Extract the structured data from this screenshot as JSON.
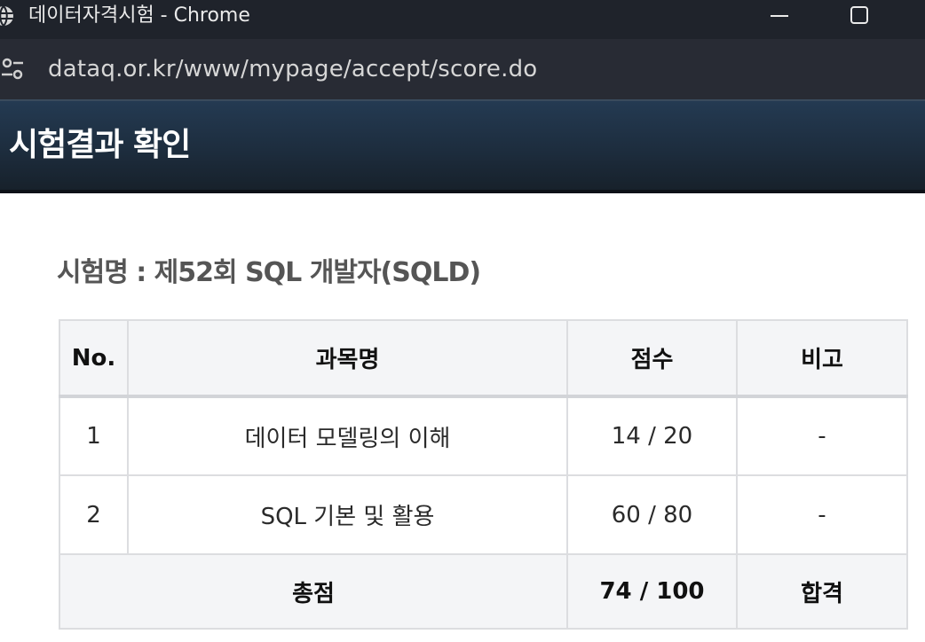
{
  "window": {
    "title": "데이터자격시험 - Chrome",
    "minimize_icon": "minimize-icon",
    "maximize_icon": "maximize-icon"
  },
  "address_bar": {
    "url": "dataq.or.kr/www/mypage/accept/score.do",
    "site_icon": "tune-icon"
  },
  "header": {
    "title": "시험결과 확인",
    "colors": {
      "background": "#1d2d3e",
      "text": "#ffffff"
    }
  },
  "exam": {
    "name": "시험명 : 제52회 SQL 개발자(SQLD)"
  },
  "table": {
    "headers": {
      "no": "No.",
      "subject": "과목명",
      "score": "점수",
      "remark": "비고"
    },
    "rows": [
      {
        "no": "1",
        "subject": "데이터 모델링의 이해",
        "score": "14 / 20",
        "remark": "-"
      },
      {
        "no": "2",
        "subject": "SQL 기본 및 활용",
        "score": "60 / 80",
        "remark": "-"
      }
    ],
    "total": {
      "label": "총점",
      "score": "74 / 100",
      "result": "합격"
    }
  }
}
